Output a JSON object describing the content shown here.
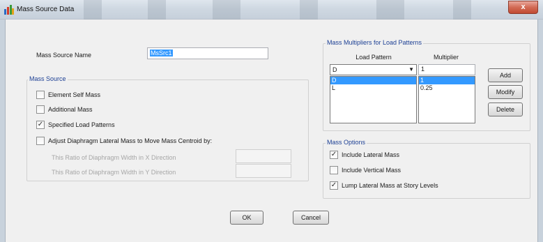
{
  "window": {
    "title": "Mass Source Data",
    "close_glyph": "x"
  },
  "mass_source_name": {
    "label": "Mass Source Name",
    "value": "MsSrc1"
  },
  "mass_source": {
    "title": "Mass Source",
    "element_self_mass": {
      "label": "Element Self Mass",
      "checked": false
    },
    "additional_mass": {
      "label": "Additional Mass",
      "checked": false
    },
    "specified_load_patterns": {
      "label": "Specified Load Patterns",
      "checked": true
    },
    "adjust_diaphragm": {
      "label": "Adjust Diaphragm Lateral Mass to Move Mass Centroid by:",
      "checked": false
    },
    "ratio_x": {
      "label": "This Ratio of Diaphragm Width in X Direction",
      "value": ""
    },
    "ratio_y": {
      "label": "This Ratio of Diaphragm Width in Y Direction",
      "value": ""
    }
  },
  "multipliers": {
    "title": "Mass Multipliers for Load Patterns",
    "col_load_pattern": "Load Pattern",
    "col_multiplier": "Multiplier",
    "combo_value": "D",
    "multiplier_input": "1",
    "rows": [
      {
        "pattern": "D",
        "multiplier": "1",
        "selected": true
      },
      {
        "pattern": "L",
        "multiplier": "0.25",
        "selected": false
      }
    ],
    "add_label": "Add",
    "modify_label": "Modify",
    "delete_label": "Delete"
  },
  "mass_options": {
    "title": "Mass Options",
    "include_lateral": {
      "label": "Include Lateral Mass",
      "checked": true
    },
    "include_vertical": {
      "label": "Include Vertical Mass",
      "checked": false
    },
    "lump_lateral": {
      "label": "Lump Lateral Mass at Story Levels",
      "checked": true
    }
  },
  "footer": {
    "ok_label": "OK",
    "cancel_label": "Cancel"
  },
  "icons": {
    "check": "check-mark-icon",
    "dropdown": "dropdown-arrow-icon",
    "app": "app-grid-icon"
  },
  "colors": {
    "accent": "#1c3f94",
    "selection": "#3399ff",
    "close": "#c14a33"
  }
}
